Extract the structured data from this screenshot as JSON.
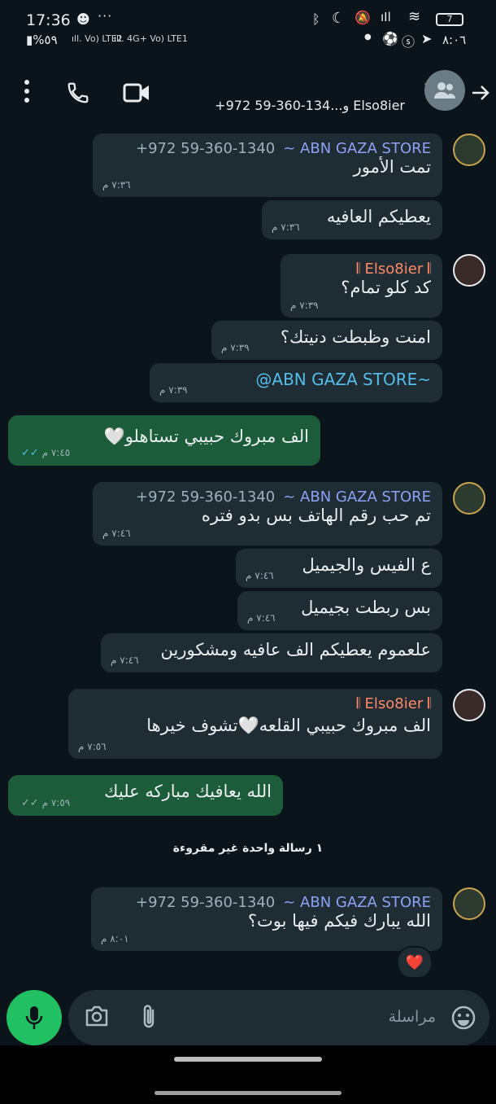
{
  "status_bar": {
    "time": "17:36",
    "battery_level": "7",
    "battery_percent": "%٥٩",
    "network_left": "Vo) LTE2",
    "network_right": "4G+ Vo) LTE1",
    "clock_right": "٨:٠٦",
    "dots": "···"
  },
  "header": {
    "title": "+972 59-360-134...و Elso8ier",
    "back_icon": "arrow-right-icon",
    "colors": {
      "background": "#0b141a",
      "text": "#e9edef"
    }
  },
  "messages": [
    {
      "sender": "ABN GAZA STORE",
      "phone": "+972 59-360-1340",
      "text": "تمت الأمور",
      "time": "٧:٣٦ م"
    },
    {
      "text": "يعطيكم العافيه",
      "time": "٧:٣٦ م"
    },
    {
      "sender": "Elso8ier",
      "text": "كد كلو تمام؟",
      "time": "٧:٣٩ م"
    },
    {
      "text": "امنت وظبطت دنيتك؟",
      "time": "٧:٣٩ م"
    },
    {
      "text": "@ABN GAZA STORE~",
      "time": "٧:٣٩ م"
    },
    {
      "text": "الف مبروك حبيبي تستاهلو🤍",
      "time": "٧:٤٥ م",
      "ticks": "✓✓"
    },
    {
      "sender": "ABN GAZA STORE",
      "phone": "+972 59-360-1340",
      "text": "تم حب رقم الهاتف بس بدو فتره",
      "time": "٧:٤٦ م"
    },
    {
      "text": "ع الفيس والجيميل",
      "time": "٧:٤٦ م"
    },
    {
      "text": "بس ربطت بجيميل",
      "time": "٧:٤٦ م"
    },
    {
      "text": "علعموم يعطيكم الف عافيه ومشكورين",
      "time": "٧:٤٦ م"
    },
    {
      "sender": "Elso8ier",
      "text": "الف مبروك حبيبي القلعه🤍تشوف خيرها",
      "time": "٧:٥٦ م"
    },
    {
      "text": "الله يعافيك مباركه عليك",
      "time": "٧:٥٩ م",
      "ticks": "✓✓"
    },
    {
      "sender": "ABN GAZA STORE",
      "phone": "+972 59-360-1340",
      "text": "الله يبارك فيكم فيها بوت؟",
      "time": "٨:٠١ م",
      "reaction": "❤️"
    }
  ],
  "unread_divider": "١ رسالة واحدة غير مقروءة",
  "composer": {
    "placeholder": "مراسلة"
  },
  "colors": {
    "accent_green": "#21c063",
    "outgoing_bubble": "#1d5c3a",
    "incoming_bubble": "#1f2c34",
    "mention": "#53bdeb"
  }
}
